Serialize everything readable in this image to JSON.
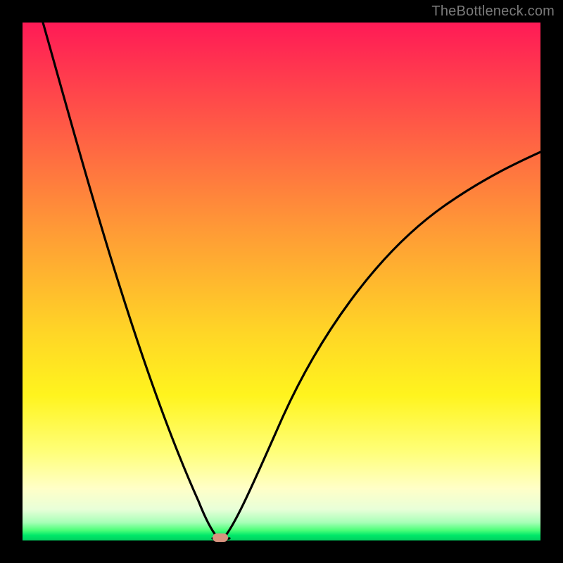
{
  "watermark": "TheBottleneck.com",
  "colors": {
    "frame": "#000000",
    "gradient_top": "#ff1a56",
    "gradient_mid": "#ffd626",
    "gradient_bottom": "#00d060",
    "curve": "#000000",
    "marker": "#d8937f"
  },
  "chart_data": {
    "type": "line",
    "title": "",
    "xlabel": "",
    "ylabel": "",
    "xlim": [
      0,
      100
    ],
    "ylim": [
      0,
      100
    ],
    "annotations": [
      {
        "type": "marker",
        "x": 38,
        "y": 0,
        "shape": "rounded-rect",
        "color": "#d8937f"
      }
    ],
    "series": [
      {
        "name": "left-branch",
        "x": [
          4,
          6,
          8,
          10,
          12,
          14,
          16,
          18,
          20,
          22,
          24,
          26,
          28,
          30,
          32,
          34,
          35,
          36,
          37,
          38
        ],
        "y": [
          100,
          92,
          84,
          76,
          68,
          61,
          54,
          47,
          41,
          35,
          29,
          24,
          19,
          14,
          10,
          6,
          4,
          2.5,
          1,
          0
        ]
      },
      {
        "name": "right-branch",
        "x": [
          38,
          40,
          42,
          44,
          46,
          48,
          50,
          52,
          55,
          58,
          61,
          64,
          67,
          70,
          73,
          76,
          80,
          84,
          88,
          92,
          96,
          100
        ],
        "y": [
          0,
          1,
          3,
          6,
          9,
          13,
          17,
          21,
          26,
          31,
          36,
          40,
          44,
          48,
          52,
          55,
          59,
          63,
          66,
          69,
          72,
          75
        ]
      }
    ]
  }
}
